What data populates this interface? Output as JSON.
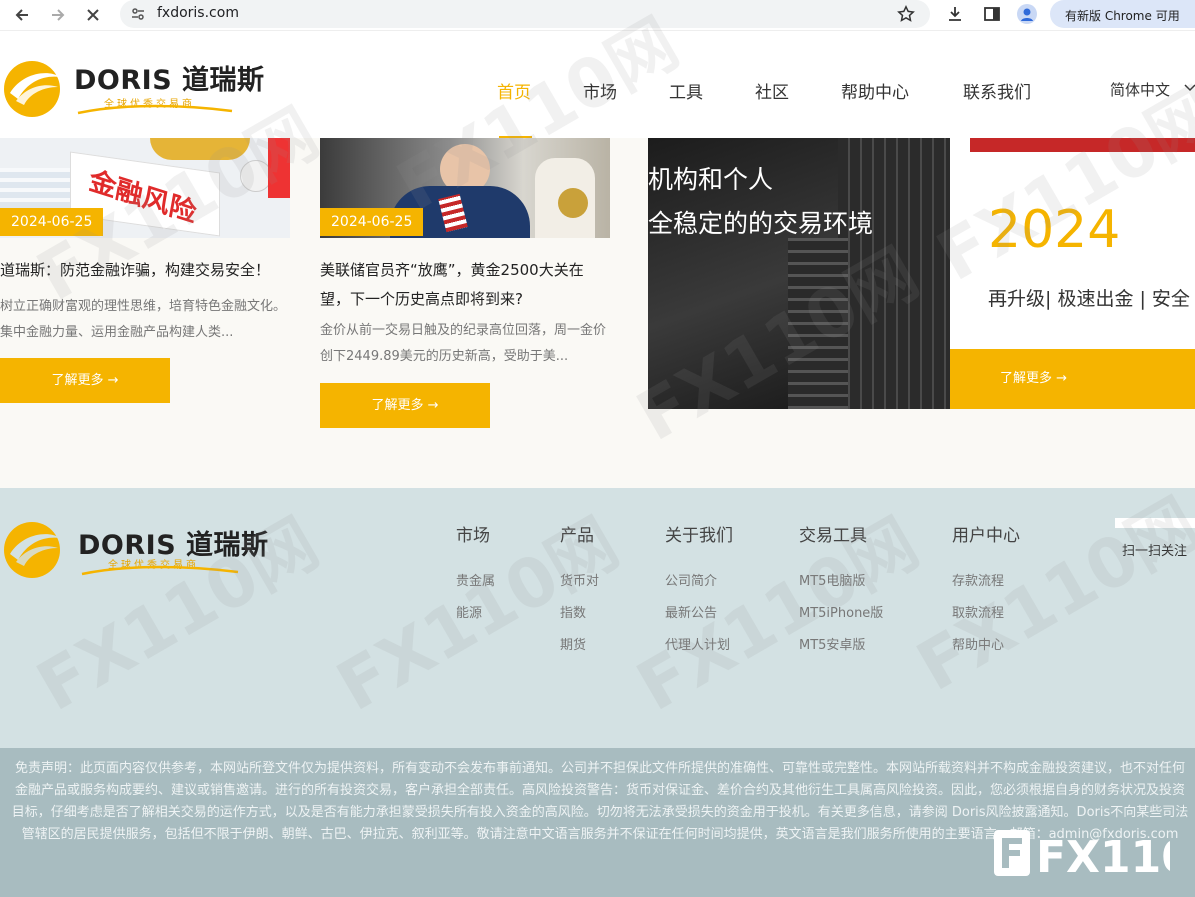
{
  "browser": {
    "url": "fxdoris.com",
    "update_chip": "有新版 Chrome 可用"
  },
  "header": {
    "logo_name": "DORIS 道瑞斯",
    "logo_tagline": "全球优秀交易商",
    "nav": [
      "首页",
      "市场",
      "工具",
      "社区",
      "帮助中心",
      "联系我们"
    ],
    "active_nav": "首页",
    "language": "简体中文"
  },
  "cards": [
    {
      "image_text": "金融风险",
      "date": "2024-06-25",
      "title": "道瑞斯：防范金融诈骗，构建交易安全！",
      "excerpt": "树立正确财富观的理性思维，培育特色金融文化。集中金融力量、运用金融产品构建人类...",
      "button": "了解更多 →"
    },
    {
      "date": "2024-06-25",
      "title": "美联储官员齐“放鹰”，黄金2500大关在望，下一个历史高点即将到来?",
      "excerpt": "金价从前一交易日触及的纪录高位回落，周一金价创下2449.89美元的历史新高，受助于美...",
      "button": "了解更多 →"
    }
  ],
  "banner": {
    "line1": "机构和个人",
    "line2": "全稳定的的交易环境",
    "year": "2024",
    "subline": "再升级| 极速出金 | 安全",
    "button": "了解更多 →"
  },
  "footer": {
    "logo_name": "DORIS 道瑞斯",
    "logo_tagline": "全球优秀交易商",
    "columns": [
      {
        "heading": "市场",
        "links": [
          "贵金属",
          "能源"
        ]
      },
      {
        "heading": "产品",
        "links": [
          "货币对",
          "指数",
          "期货"
        ]
      },
      {
        "heading": "关于我们",
        "links": [
          "公司简介",
          "最新公告",
          "代理人计划"
        ]
      },
      {
        "heading": "交易工具",
        "links": [
          "MT5电脑版",
          "MT5iPhone版",
          "MT5安卓版"
        ]
      },
      {
        "heading": "用户中心",
        "links": [
          "存款流程",
          "取款流程",
          "帮助中心"
        ]
      }
    ],
    "qr_caption": "扫一扫关注"
  },
  "disclaimer": "免责声明：此页面内容仅供参考，本网站所登文件仅为提供资料，所有变动不会发布事前通知。公司并不担保此文件所提供的准确性、可靠性或完整性。本网站所载资料并不构成金融投资建议，也不对任何金融产品或服务构成要约、建议或销售邀请。进行的所有投资交易，客户承担全部责任。高风险投资警告：货币对保证金、差价合约及其他衍生工具属高风险投资。因此，您必须根据自身的财务状况及投资目标，仔细考虑是否了解相关交易的运作方式，以及是否有能力承担蒙受损失所有投入资金的高风险。切勿将无法承受损失的资金用于投机。有关更多信息，请参阅 Doris风险披露通知。Doris不向某些司法管辖区的居民提供服务，包括但不限于伊朗、朝鲜、古巴、伊拉克、叙利亚等。敬请注意中文语言服务并不保证在任何时间均提供，英文语言是我们服务所使用的主要语言。邮箱：admin@fxdoris.com",
  "watermark": "FX110网",
  "colors": {
    "accent": "#f5b400",
    "footer_bg": "#d3e1e3",
    "disclaimer_bg": "#a8bcc0"
  }
}
